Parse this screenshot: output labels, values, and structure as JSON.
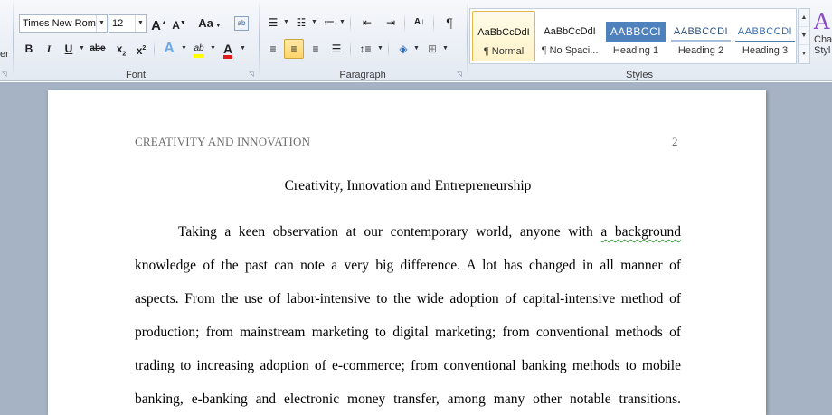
{
  "ribbon": {
    "left_stub": "er",
    "font": {
      "label": "Font",
      "font_name": "Times New Rom",
      "font_size": "12",
      "grow": "A",
      "shrink": "A",
      "change_case": "Aa",
      "clear_format": "ab",
      "bold": "B",
      "italic": "I",
      "underline": "U",
      "strike": "abe",
      "subscript": "x",
      "superscript": "x",
      "text_effects": "A",
      "highlight": "ab",
      "font_color": "A"
    },
    "paragraph": {
      "label": "Paragraph",
      "sort": "A↓",
      "pilcrow": "¶"
    },
    "styles": {
      "label": "Styles",
      "items": [
        {
          "sample": "AaBbCcDdI",
          "name": "¶ Normal"
        },
        {
          "sample": "AaBbCcDdI",
          "name": "¶ No Spaci..."
        },
        {
          "sample": "AABBCCI",
          "name": "Heading 1"
        },
        {
          "sample": "AABBCCDI",
          "name": "Heading 2"
        },
        {
          "sample": "AABBCCDI",
          "name": "Heading 3"
        }
      ],
      "change_styles": [
        "Cha",
        "Styl"
      ]
    }
  },
  "document": {
    "header_left": "CREATIVITY AND INNOVATION",
    "page_number": "2",
    "title": "Creativity, Innovation and Entrepreneurship",
    "lines": [
      {
        "text": "Taking a keen observation at our contemporary world, anyone with ",
        "flag": "a background"
      },
      {
        "text": "knowledge of the past can note a very big difference. A lot has changed in all manner of"
      },
      {
        "text": "aspects. From the use of labor-intensive to the wide adoption of capital-intensive method of"
      },
      {
        "text": "production; from mainstream marketing to digital marketing; from conventional methods of"
      },
      {
        "text": "trading to increasing adoption of e-commerce; from conventional banking methods to mobile"
      },
      {
        "text": "banking, e-banking and electronic money transfer, among many other notable transitions."
      }
    ]
  },
  "colors": {
    "ribbon_top": "#f6f8fb",
    "ribbon_bottom": "#e3e9f2",
    "doc_background": "#a6b3c4",
    "heading1_fill": "#4f81bd",
    "selected_button": "#ffd56a",
    "spell_underline": "#3aa03a"
  }
}
